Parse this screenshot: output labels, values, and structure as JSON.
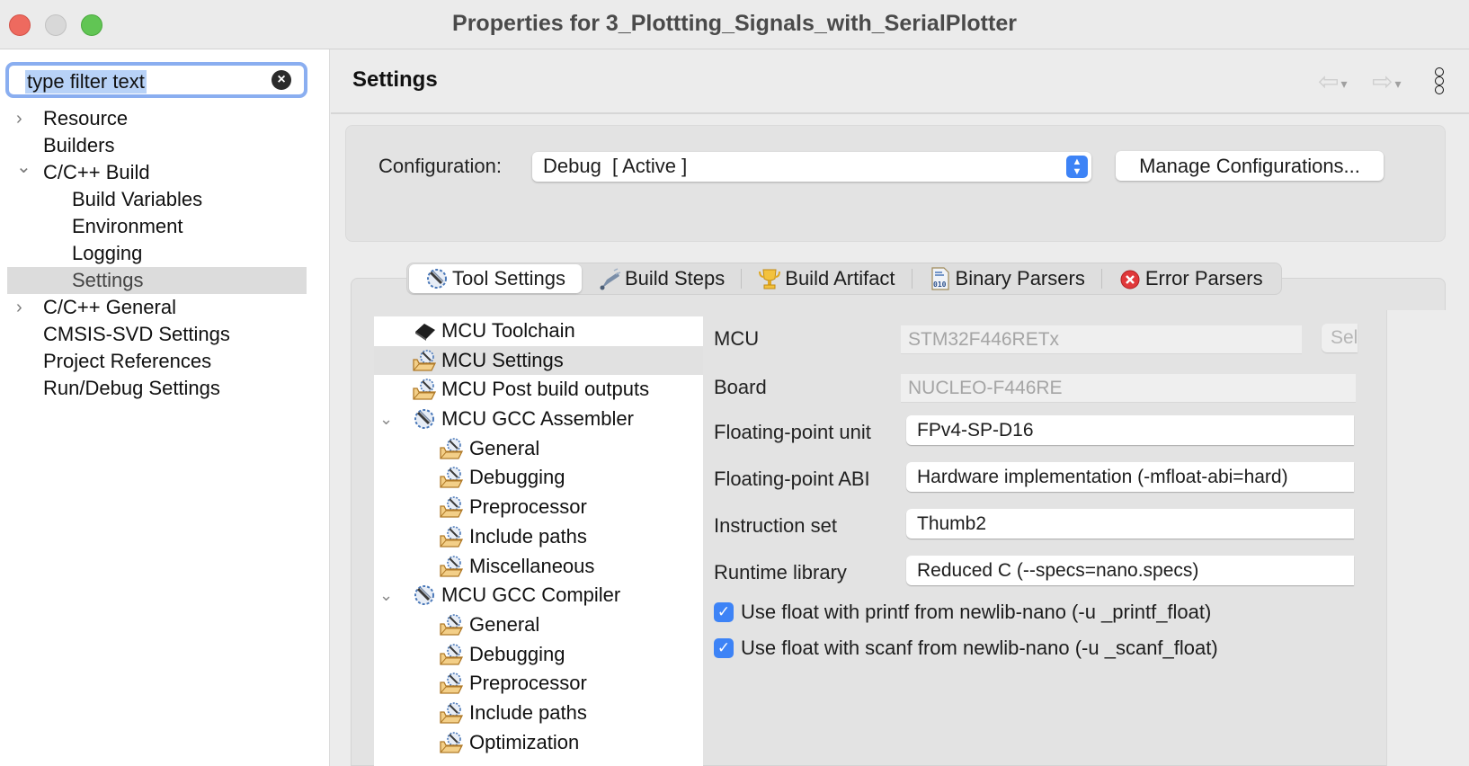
{
  "window": {
    "title": "Properties for 3_Plottting_Signals_with_SerialPlotter"
  },
  "sidebar": {
    "filter": {
      "value": "type filter text",
      "clear_icon": "×"
    },
    "items": [
      {
        "label": "Resource",
        "chevron": "›",
        "expanded": false,
        "level": 0
      },
      {
        "label": "Builders",
        "chevron": "",
        "level": 0
      },
      {
        "label": "C/C++ Build",
        "chevron": "⌄",
        "expanded": true,
        "level": 0
      },
      {
        "label": "Build Variables",
        "level": 1
      },
      {
        "label": "Environment",
        "level": 1
      },
      {
        "label": "Logging",
        "level": 1
      },
      {
        "label": "Settings",
        "level": 1,
        "selected": true
      },
      {
        "label": "C/C++ General",
        "chevron": "›",
        "expanded": false,
        "level": 0
      },
      {
        "label": "CMSIS-SVD Settings",
        "level": 0
      },
      {
        "label": "Project References",
        "level": 0
      },
      {
        "label": "Run/Debug Settings",
        "level": 0
      }
    ]
  },
  "header": {
    "title": "Settings",
    "back_icon": "⇦",
    "forward_icon": "⇨",
    "dropdown_icon": "▾"
  },
  "configuration": {
    "label": "Configuration:",
    "value": "Debug  [ Active ]",
    "manage_button": "Manage Configurations..."
  },
  "tabs": [
    {
      "label": "Tool Settings",
      "icon": "tool-settings-icon",
      "active": true
    },
    {
      "label": "Build Steps",
      "icon": "build-steps-icon"
    },
    {
      "label": "Build Artifact",
      "icon": "trophy-icon"
    },
    {
      "label": "Binary Parsers",
      "icon": "binary-file-icon"
    },
    {
      "label": "Error Parsers",
      "icon": "error-icon"
    }
  ],
  "tool_tree": [
    {
      "label": "MCU Toolchain",
      "icon": "chip",
      "level": 0
    },
    {
      "label": "MCU Settings",
      "icon": "folder-gear",
      "level": 0,
      "selected": true
    },
    {
      "label": "MCU Post build outputs",
      "icon": "folder-gear",
      "level": 0
    },
    {
      "label": "MCU GCC Assembler",
      "icon": "tool",
      "level": 0,
      "expanded": true
    },
    {
      "label": "General",
      "icon": "folder-gear",
      "level": 1
    },
    {
      "label": "Debugging",
      "icon": "folder-gear",
      "level": 1
    },
    {
      "label": "Preprocessor",
      "icon": "folder-gear",
      "level": 1
    },
    {
      "label": "Include paths",
      "icon": "folder-gear",
      "level": 1
    },
    {
      "label": "Miscellaneous",
      "icon": "folder-gear",
      "level": 1
    },
    {
      "label": "MCU GCC Compiler",
      "icon": "tool",
      "level": 0,
      "expanded": true
    },
    {
      "label": "General",
      "icon": "folder-gear",
      "level": 1
    },
    {
      "label": "Debugging",
      "icon": "folder-gear",
      "level": 1
    },
    {
      "label": "Preprocessor",
      "icon": "folder-gear",
      "level": 1
    },
    {
      "label": "Include paths",
      "icon": "folder-gear",
      "level": 1
    },
    {
      "label": "Optimization",
      "icon": "folder-gear",
      "level": 1
    }
  ],
  "form": {
    "mcu": {
      "label": "MCU",
      "value": "STM32F446RETx",
      "select_button": "Select..."
    },
    "board": {
      "label": "Board",
      "value": "NUCLEO-F446RE"
    },
    "fpu": {
      "label": "Floating-point unit",
      "value": "FPv4-SP-D16"
    },
    "fp_abi": {
      "label": "Floating-point ABI",
      "value": "Hardware implementation (-mfloat-abi=hard)"
    },
    "instruction_set": {
      "label": "Instruction set",
      "value": "Thumb2"
    },
    "runtime_library": {
      "label": "Runtime library",
      "value": "Reduced C (--specs=nano.specs)"
    },
    "printf_float": {
      "label": "Use float with printf from newlib-nano (-u _printf_float)",
      "checked": true
    },
    "scanf_float": {
      "label": "Use float with scanf from newlib-nano (-u _scanf_float)",
      "checked": true
    }
  },
  "colors": {
    "accent": "#3d83f6",
    "focus_ring": "#8aaef0",
    "selection": "#b8d2f7",
    "close": "#ee6a5f",
    "minimize": "#d8d8d8",
    "maximize": "#61c554"
  }
}
